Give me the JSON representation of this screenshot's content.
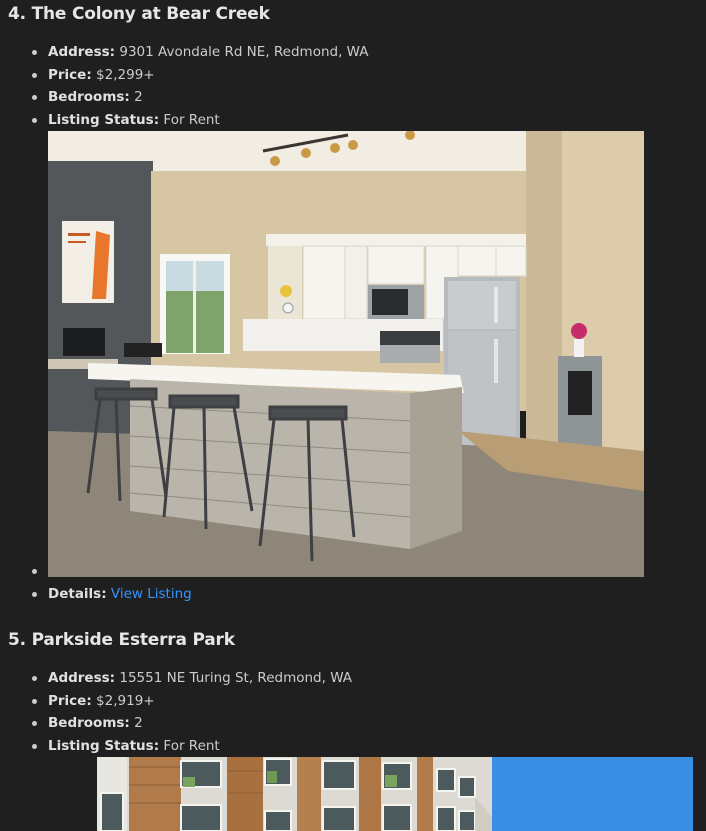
{
  "listing4": {
    "heading": "4. The Colony at Bear Creek",
    "address_label": "Address:",
    "address": "9301 Avondale Rd NE, Redmond, WA",
    "price_label": "Price:",
    "price": "$2,299+",
    "bedrooms_label": "Bedrooms:",
    "bedrooms": "2",
    "status_label": "Listing Status:",
    "status": "For Rent",
    "details_label": "Details:",
    "details_link": "View Listing"
  },
  "listing5": {
    "heading": "5. Parkside Esterra Park",
    "address_label": "Address:",
    "address": "15551 NE Turing St, Redmond, WA",
    "price_label": "Price:",
    "price": "$2,919+",
    "bedrooms_label": "Bedrooms:",
    "bedrooms": "2",
    "status_label": "Listing Status:",
    "status": "For Rent"
  },
  "colors": {
    "background": "#1f1f1f",
    "text": "#cccccc",
    "link": "#3794ff"
  },
  "icons": {
    "kitchen_photo": "kitchen-photo",
    "building_photo": "building-photo"
  }
}
